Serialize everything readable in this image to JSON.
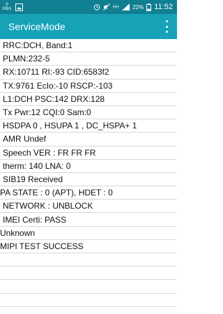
{
  "status_bar": {
    "speed_value": "0",
    "speed_unit": "KB/s",
    "network_type": "H+",
    "battery": "22%",
    "time": "11:52"
  },
  "app_bar": {
    "title": "ServiceMode"
  },
  "rows": [
    {
      "text": "RRC:DCH, Band:1",
      "indent": 1
    },
    {
      "text": "PLMN:232-5",
      "indent": 1
    },
    {
      "text": "RX:10711 RI:-93 CID:6583f2",
      "indent": 1
    },
    {
      "text": "TX:9761 EcIo:-10 RSCP:-103",
      "indent": 1
    },
    {
      "text": "L1:DCH PSC:142 DRX:128",
      "indent": 1
    },
    {
      "text": "Tx Pwr:12 CQI:0 Sam:0",
      "indent": 1
    },
    {
      "text": " HSDPA 0 , HSUPA 1 , DC_HSPA+ 1",
      "indent": 1
    },
    {
      "text": " AMR Undef",
      "indent": 1
    },
    {
      "text": " Speech VER : FR FR FR",
      "indent": 1
    },
    {
      "text": " therm: 140 LNA: 0",
      "indent": 1
    },
    {
      "text": " SIB19 Received",
      "indent": 1
    },
    {
      "text": "PA STATE : 0 (APT), HDET : 0",
      "indent": 0
    },
    {
      "text": " NETWORK : UNBLOCK",
      "indent": 1
    },
    {
      "text": " IMEI Certi: PASS",
      "indent": 1
    },
    {
      "text": "Unknown",
      "indent": 0
    },
    {
      "text": "MIPI TEST SUCCESS",
      "indent": 0
    },
    {
      "text": "",
      "indent": 0
    },
    {
      "text": "",
      "indent": 0
    },
    {
      "text": "",
      "indent": 0
    },
    {
      "text": "",
      "indent": 0
    }
  ],
  "colors": {
    "status_bar": "#0f7f91",
    "app_bar": "#17a2b8",
    "divider": "#d8d8d8"
  }
}
